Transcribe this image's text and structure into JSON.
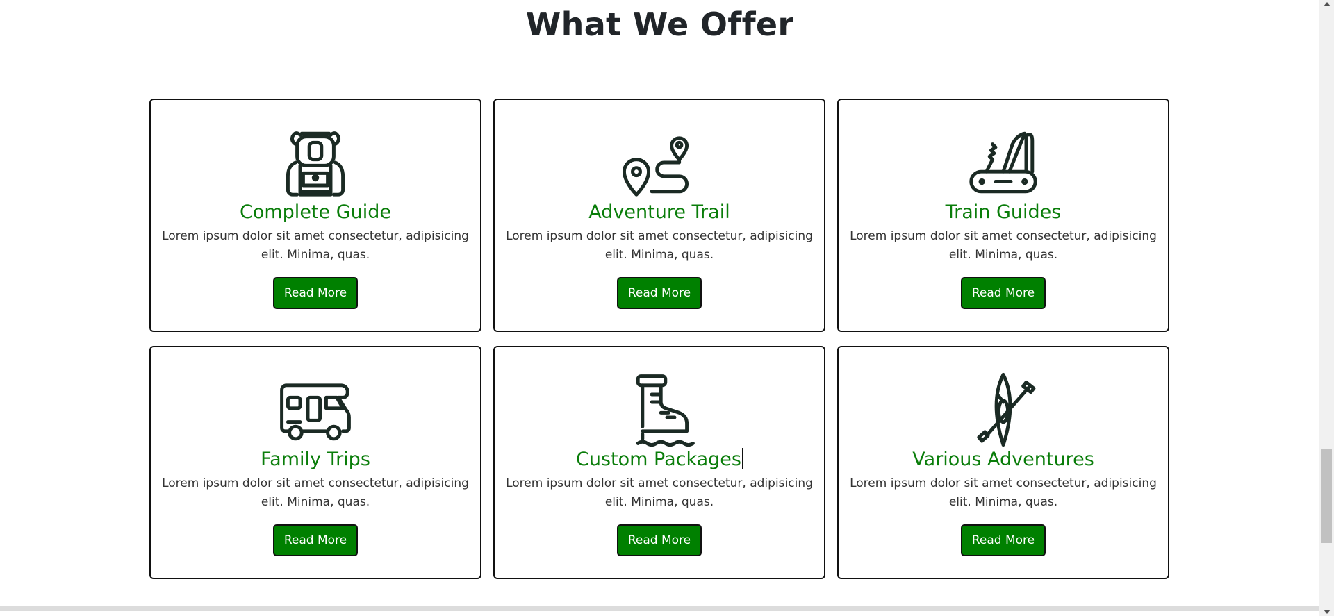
{
  "section": {
    "title": "What We Offer"
  },
  "cards": [
    {
      "title": "Complete Guide",
      "text": "Lorem ipsum dolor sit amet consectetur, adipisicing elit. Minima, quas.",
      "button": "Read More",
      "icon": "backpack-icon"
    },
    {
      "title": "Adventure Trail",
      "text": "Lorem ipsum dolor sit amet consectetur, adipisicing elit. Minima, quas.",
      "button": "Read More",
      "icon": "map-route-icon"
    },
    {
      "title": "Train Guides",
      "text": "Lorem ipsum dolor sit amet consectetur, adipisicing elit. Minima, quas.",
      "button": "Read More",
      "icon": "pocket-knife-icon"
    },
    {
      "title": "Family Trips",
      "text": "Lorem ipsum dolor sit amet consectetur, adipisicing elit. Minima, quas.",
      "button": "Read More",
      "icon": "camper-van-icon"
    },
    {
      "title": "Custom Packages",
      "text": "Lorem ipsum dolor sit amet consectetur, adipisicing elit. Minima, quas.",
      "button": "Read More",
      "icon": "hiking-boot-icon"
    },
    {
      "title": "Various Adventures",
      "text": "Lorem ipsum dolor sit amet consectetur, adipisicing elit. Minima, quas.",
      "button": "Read More",
      "icon": "kayak-icon"
    }
  ],
  "colors": {
    "accent": "#008000",
    "title_green": "#0a7d0a",
    "text": "#333333",
    "heading": "#212529"
  }
}
